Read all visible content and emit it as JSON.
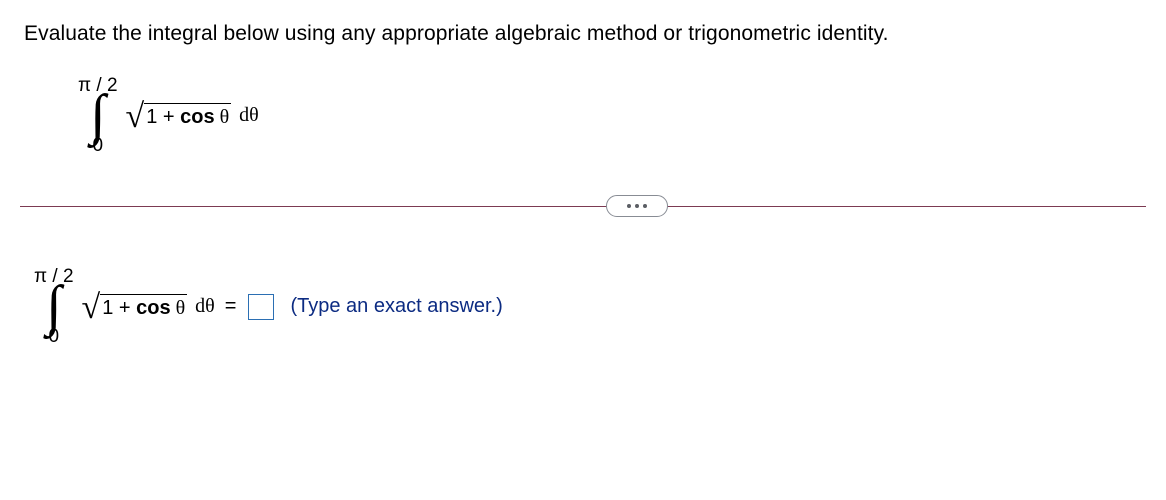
{
  "prompt": "Evaluate the integral below using any appropriate algebraic method or trigonometric identity.",
  "integral1": {
    "upper": "π / 2",
    "lower": "0",
    "radicand": "1 + ",
    "cos": "cos",
    "theta": " θ",
    "diff": " dθ"
  },
  "integral2": {
    "upper": "π / 2",
    "lower": "0",
    "radicand": "1 + ",
    "cos": "cos",
    "theta": " θ",
    "diff": " dθ",
    "equals": "="
  },
  "answer_box": "",
  "hint": "(Type an exact answer.)"
}
